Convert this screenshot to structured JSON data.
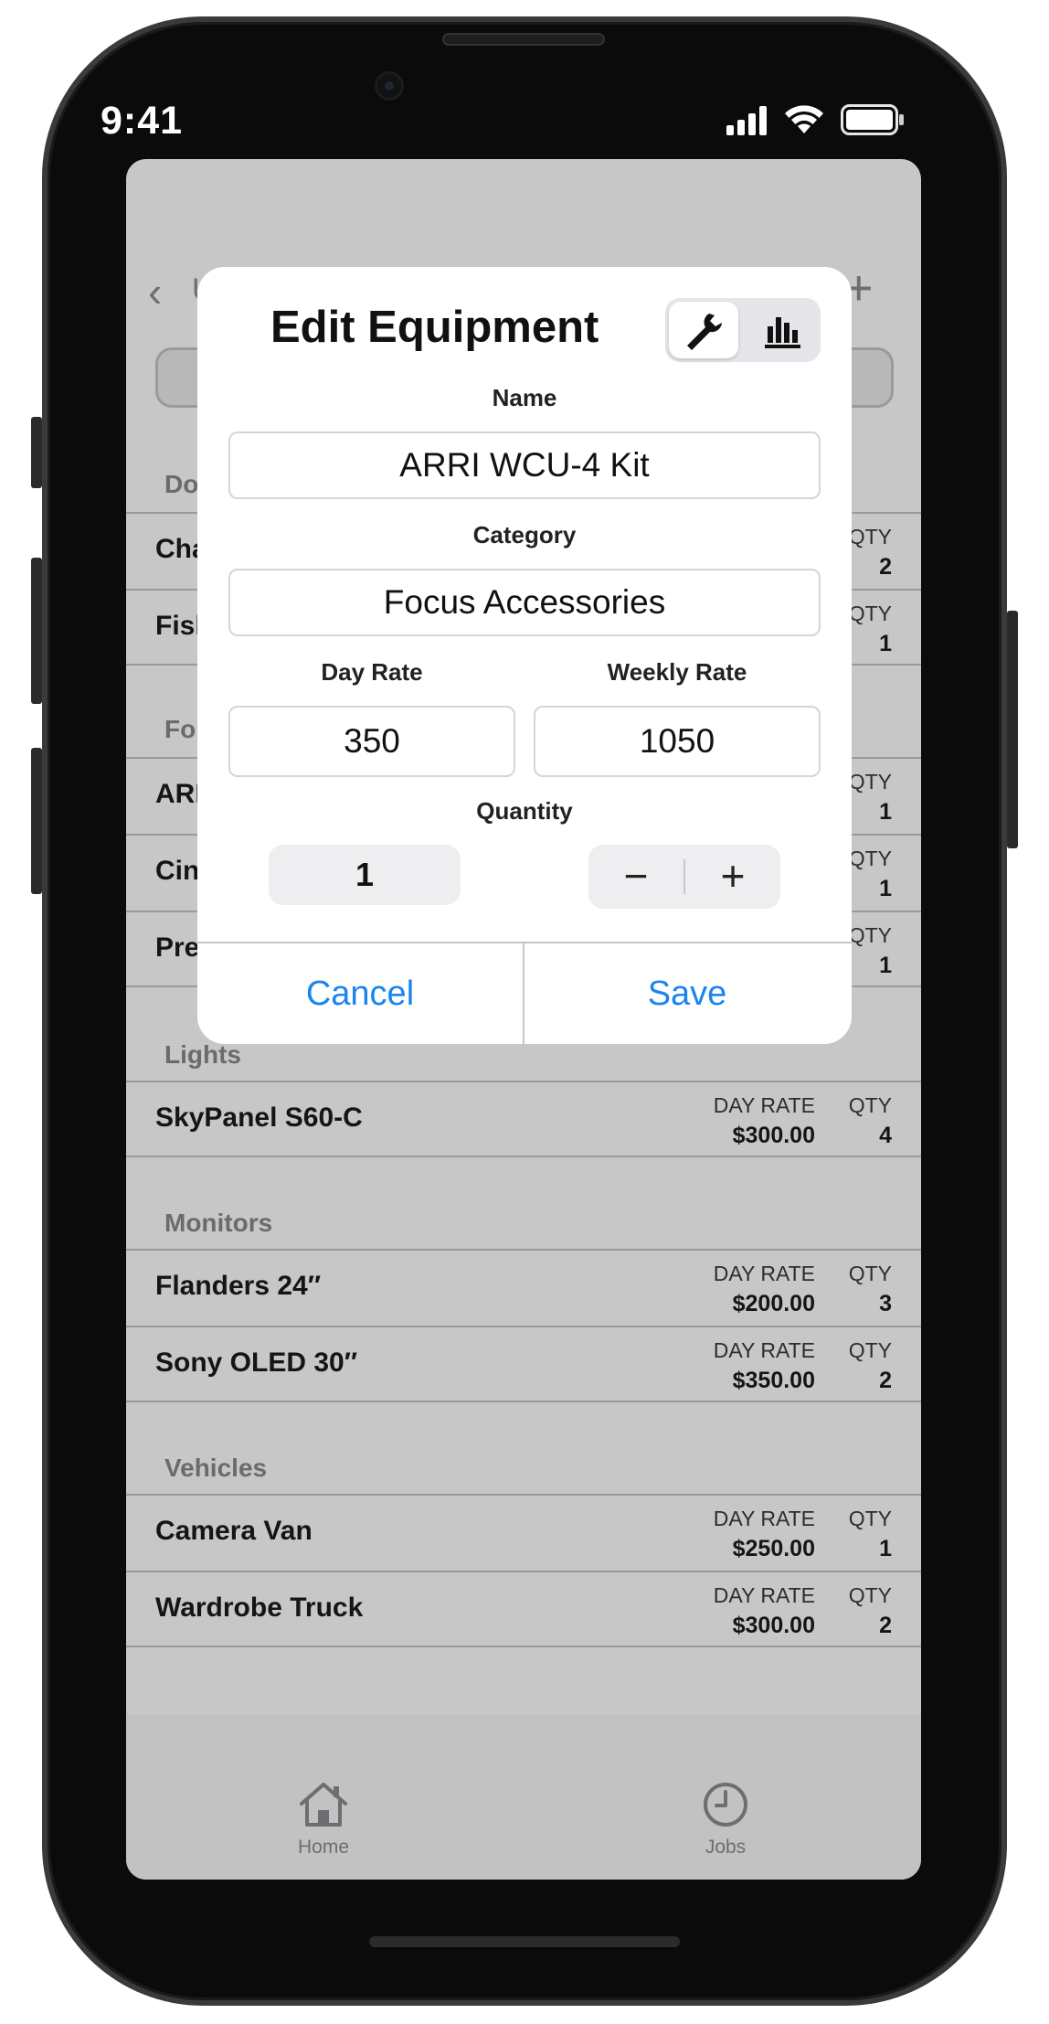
{
  "status_bar": {
    "time": "9:41"
  },
  "list": {
    "back_label": "U",
    "sections": [
      {
        "header": "Do",
        "rows": [
          {
            "name": "Cha",
            "qty_label": "QTY",
            "qty": "2"
          },
          {
            "name": "Fish",
            "qty_label": "QTY",
            "qty": "1"
          }
        ]
      },
      {
        "header": "Fo",
        "rows": [
          {
            "name": "ARI",
            "qty_label": "QTY",
            "qty": "1"
          },
          {
            "name": "Cin",
            "qty_label": "QTY",
            "qty": "1"
          },
          {
            "name": "Pre",
            "qty_label": "QTY",
            "qty": "1"
          }
        ]
      },
      {
        "header": "Lights",
        "rows": [
          {
            "name": "SkyPanel S60-C",
            "day_label": "DAY RATE",
            "day": "$300.00",
            "qty_label": "QTY",
            "qty": "4"
          }
        ]
      },
      {
        "header": "Monitors",
        "rows": [
          {
            "name": "Flanders 24″",
            "day_label": "DAY RATE",
            "day": "$200.00",
            "qty_label": "QTY",
            "qty": "3"
          },
          {
            "name": "Sony OLED 30″",
            "day_label": "DAY RATE",
            "day": "$350.00",
            "qty_label": "QTY",
            "qty": "2"
          }
        ]
      },
      {
        "header": "Vehicles",
        "rows": [
          {
            "name": "Camera Van",
            "day_label": "DAY RATE",
            "day": "$250.00",
            "qty_label": "QTY",
            "qty": "1"
          },
          {
            "name": "Wardrobe Truck",
            "day_label": "DAY RATE",
            "day": "$300.00",
            "qty_label": "QTY",
            "qty": "2"
          }
        ]
      }
    ]
  },
  "tabbar": {
    "home": "Home",
    "jobs": "Jobs"
  },
  "modal": {
    "title": "Edit Equipment",
    "segments": [
      "wrench-icon",
      "chart-bars-icon"
    ],
    "selected_segment": 0,
    "name_label": "Name",
    "name_value": "ARRI WCU-4 Kit",
    "category_label": "Category",
    "category_value": "Focus Accessories",
    "day_rate_label": "Day Rate",
    "day_rate_value": "350",
    "weekly_rate_label": "Weekly Rate",
    "weekly_rate_value": "1050",
    "quantity_label": "Quantity",
    "quantity_value": "1",
    "minus": "−",
    "plus": "+",
    "cancel": "Cancel",
    "save": "Save"
  },
  "colors": {
    "accent": "#1a84f0",
    "dim_overlay": "rgba(0,0,0,0.22)"
  }
}
